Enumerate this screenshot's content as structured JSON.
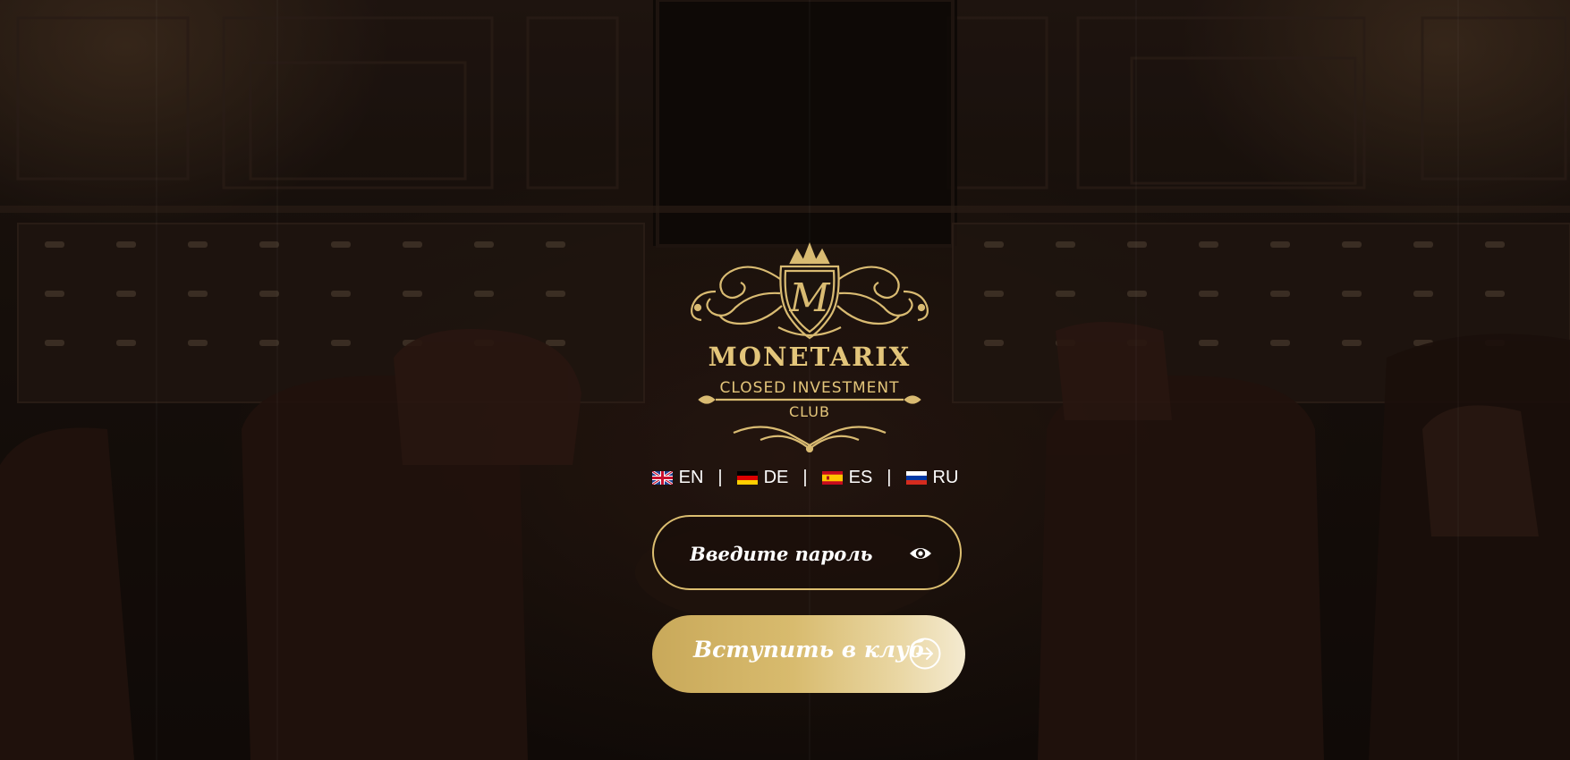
{
  "brand": {
    "name": "MONETARIX",
    "tagline_line1": "CLOSED INVESTMENT",
    "tagline_line2": "CLUB",
    "logo_letter": "M",
    "gold_color": "#e3c57a"
  },
  "languages": [
    {
      "code": "EN",
      "flag": "uk-flag-icon"
    },
    {
      "code": "DE",
      "flag": "germany-flag-icon"
    },
    {
      "code": "ES",
      "flag": "spain-flag-icon"
    },
    {
      "code": "RU",
      "flag": "russia-flag-icon"
    }
  ],
  "language_separator": "|",
  "password": {
    "placeholder": "Введите пароль",
    "value": "",
    "toggle_icon": "eye-icon"
  },
  "join_button": {
    "label": "Вступить в клуб",
    "icon": "arrow-right-circle-icon"
  },
  "colors": {
    "accent": "#dcbe70",
    "button_gradient_start": "#c9a95a",
    "button_gradient_end": "#f4ead0",
    "text": "#ffffff"
  }
}
